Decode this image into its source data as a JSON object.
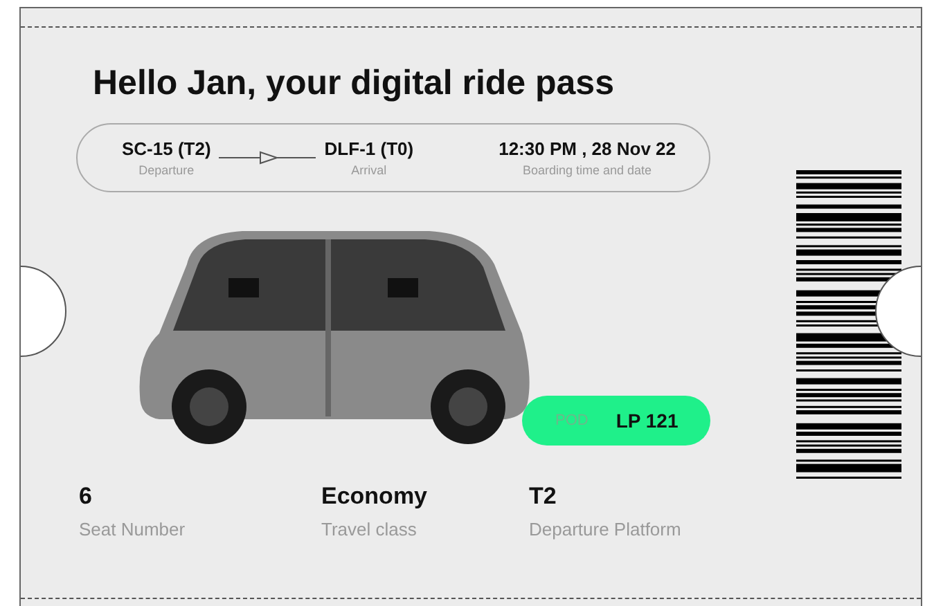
{
  "greeting": "Hello Jan, your digital ride pass",
  "route": {
    "departure": {
      "value": "SC-15 (T2)",
      "label": "Departure"
    },
    "arrival": {
      "value": "DLF-1 (T0)",
      "label": "Arrival"
    },
    "boarding": {
      "value": "12:30 PM , 28 Nov 22",
      "label": "Boarding time and date"
    }
  },
  "pod": {
    "label": "POD",
    "value": "LP 121"
  },
  "details": [
    {
      "value": "6",
      "label": "Seat Number"
    },
    {
      "value": "Economy",
      "label": "Travel class"
    },
    {
      "value": "T2",
      "label": "Departure Platform"
    }
  ]
}
